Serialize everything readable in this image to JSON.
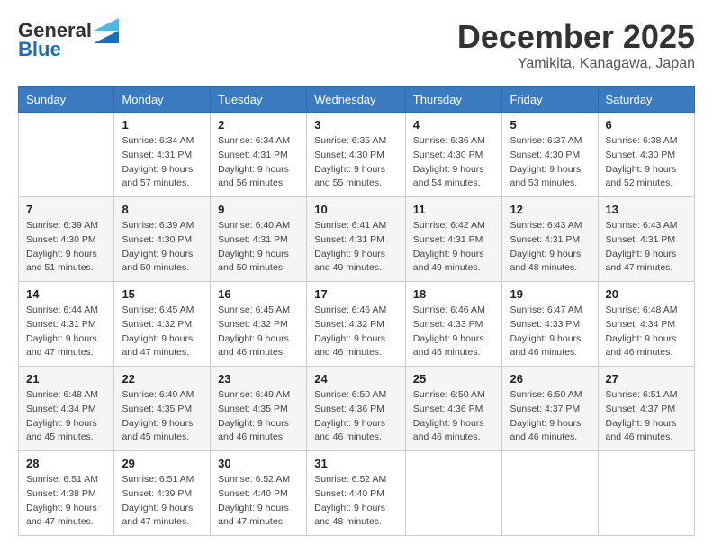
{
  "header": {
    "logo": {
      "general": "General",
      "blue": "Blue"
    },
    "month": "December 2025",
    "location": "Yamikita, Kanagawa, Japan"
  },
  "calendar": {
    "headers": [
      "Sunday",
      "Monday",
      "Tuesday",
      "Wednesday",
      "Thursday",
      "Friday",
      "Saturday"
    ],
    "rows": [
      [
        {
          "day": "",
          "info": ""
        },
        {
          "day": "1",
          "info": "Sunrise: 6:34 AM\nSunset: 4:31 PM\nDaylight: 9 hours\nand 57 minutes."
        },
        {
          "day": "2",
          "info": "Sunrise: 6:34 AM\nSunset: 4:31 PM\nDaylight: 9 hours\nand 56 minutes."
        },
        {
          "day": "3",
          "info": "Sunrise: 6:35 AM\nSunset: 4:30 PM\nDaylight: 9 hours\nand 55 minutes."
        },
        {
          "day": "4",
          "info": "Sunrise: 6:36 AM\nSunset: 4:30 PM\nDaylight: 9 hours\nand 54 minutes."
        },
        {
          "day": "5",
          "info": "Sunrise: 6:37 AM\nSunset: 4:30 PM\nDaylight: 9 hours\nand 53 minutes."
        },
        {
          "day": "6",
          "info": "Sunrise: 6:38 AM\nSunset: 4:30 PM\nDaylight: 9 hours\nand 52 minutes."
        }
      ],
      [
        {
          "day": "7",
          "info": "Sunrise: 6:39 AM\nSunset: 4:30 PM\nDaylight: 9 hours\nand 51 minutes."
        },
        {
          "day": "8",
          "info": "Sunrise: 6:39 AM\nSunset: 4:30 PM\nDaylight: 9 hours\nand 50 minutes."
        },
        {
          "day": "9",
          "info": "Sunrise: 6:40 AM\nSunset: 4:31 PM\nDaylight: 9 hours\nand 50 minutes."
        },
        {
          "day": "10",
          "info": "Sunrise: 6:41 AM\nSunset: 4:31 PM\nDaylight: 9 hours\nand 49 minutes."
        },
        {
          "day": "11",
          "info": "Sunrise: 6:42 AM\nSunset: 4:31 PM\nDaylight: 9 hours\nand 49 minutes."
        },
        {
          "day": "12",
          "info": "Sunrise: 6:43 AM\nSunset: 4:31 PM\nDaylight: 9 hours\nand 48 minutes."
        },
        {
          "day": "13",
          "info": "Sunrise: 6:43 AM\nSunset: 4:31 PM\nDaylight: 9 hours\nand 47 minutes."
        }
      ],
      [
        {
          "day": "14",
          "info": "Sunrise: 6:44 AM\nSunset: 4:31 PM\nDaylight: 9 hours\nand 47 minutes."
        },
        {
          "day": "15",
          "info": "Sunrise: 6:45 AM\nSunset: 4:32 PM\nDaylight: 9 hours\nand 47 minutes."
        },
        {
          "day": "16",
          "info": "Sunrise: 6:45 AM\nSunset: 4:32 PM\nDaylight: 9 hours\nand 46 minutes."
        },
        {
          "day": "17",
          "info": "Sunrise: 6:46 AM\nSunset: 4:32 PM\nDaylight: 9 hours\nand 46 minutes."
        },
        {
          "day": "18",
          "info": "Sunrise: 6:46 AM\nSunset: 4:33 PM\nDaylight: 9 hours\nand 46 minutes."
        },
        {
          "day": "19",
          "info": "Sunrise: 6:47 AM\nSunset: 4:33 PM\nDaylight: 9 hours\nand 46 minutes."
        },
        {
          "day": "20",
          "info": "Sunrise: 6:48 AM\nSunset: 4:34 PM\nDaylight: 9 hours\nand 46 minutes."
        }
      ],
      [
        {
          "day": "21",
          "info": "Sunrise: 6:48 AM\nSunset: 4:34 PM\nDaylight: 9 hours\nand 45 minutes."
        },
        {
          "day": "22",
          "info": "Sunrise: 6:49 AM\nSunset: 4:35 PM\nDaylight: 9 hours\nand 45 minutes."
        },
        {
          "day": "23",
          "info": "Sunrise: 6:49 AM\nSunset: 4:35 PM\nDaylight: 9 hours\nand 46 minutes."
        },
        {
          "day": "24",
          "info": "Sunrise: 6:50 AM\nSunset: 4:36 PM\nDaylight: 9 hours\nand 46 minutes."
        },
        {
          "day": "25",
          "info": "Sunrise: 6:50 AM\nSunset: 4:36 PM\nDaylight: 9 hours\nand 46 minutes."
        },
        {
          "day": "26",
          "info": "Sunrise: 6:50 AM\nSunset: 4:37 PM\nDaylight: 9 hours\nand 46 minutes."
        },
        {
          "day": "27",
          "info": "Sunrise: 6:51 AM\nSunset: 4:37 PM\nDaylight: 9 hours\nand 46 minutes."
        }
      ],
      [
        {
          "day": "28",
          "info": "Sunrise: 6:51 AM\nSunset: 4:38 PM\nDaylight: 9 hours\nand 47 minutes."
        },
        {
          "day": "29",
          "info": "Sunrise: 6:51 AM\nSunset: 4:39 PM\nDaylight: 9 hours\nand 47 minutes."
        },
        {
          "day": "30",
          "info": "Sunrise: 6:52 AM\nSunset: 4:40 PM\nDaylight: 9 hours\nand 47 minutes."
        },
        {
          "day": "31",
          "info": "Sunrise: 6:52 AM\nSunset: 4:40 PM\nDaylight: 9 hours\nand 48 minutes."
        },
        {
          "day": "",
          "info": ""
        },
        {
          "day": "",
          "info": ""
        },
        {
          "day": "",
          "info": ""
        }
      ]
    ]
  }
}
